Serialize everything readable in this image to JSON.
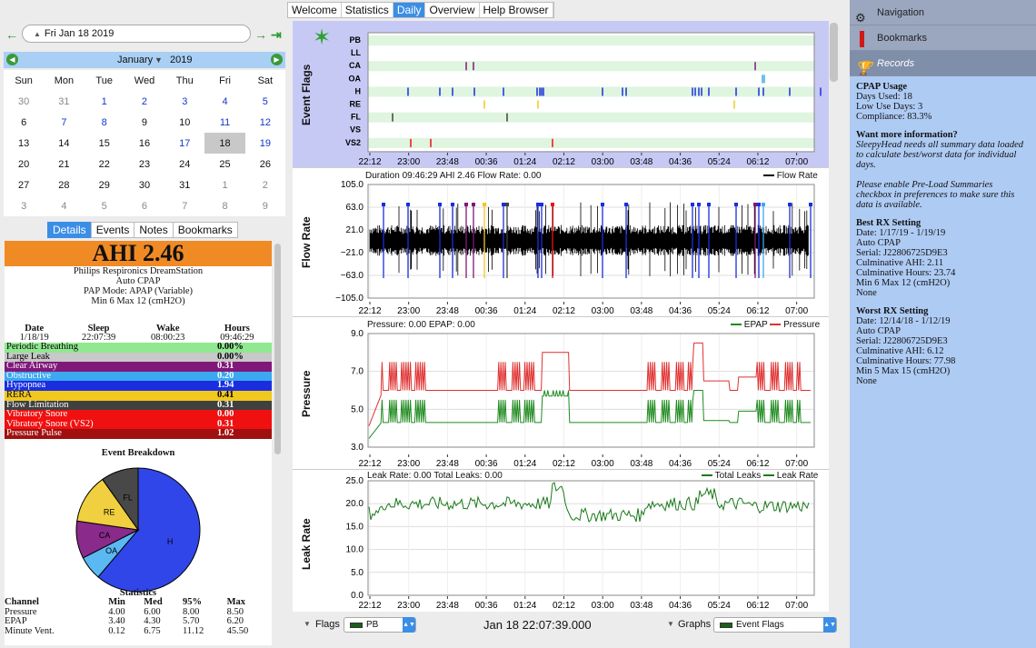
{
  "app_tabs": [
    "Welcome",
    "Statistics",
    "Daily",
    "Overview",
    "Help Browser"
  ],
  "active_tab": "Daily",
  "date_selector": {
    "value": "Fri Jan 18 2019"
  },
  "calendar": {
    "month": "January",
    "year": "2019",
    "weekdays": [
      "Sun",
      "Mon",
      "Tue",
      "Wed",
      "Thu",
      "Fri",
      "Sat"
    ],
    "weeks": [
      [
        "30",
        "31",
        "1",
        "2",
        "3",
        "4",
        "5"
      ],
      [
        "6",
        "7",
        "8",
        "9",
        "10",
        "11",
        "12"
      ],
      [
        "13",
        "14",
        "15",
        "16",
        "17",
        "18",
        "19"
      ],
      [
        "20",
        "21",
        "22",
        "23",
        "24",
        "25",
        "26"
      ],
      [
        "27",
        "28",
        "29",
        "30",
        "31",
        "1",
        "2"
      ],
      [
        "3",
        "4",
        "5",
        "6",
        "7",
        "8",
        "9"
      ]
    ],
    "selected": "18"
  },
  "detail_tabs": [
    "Details",
    "Events",
    "Notes",
    "Bookmarks"
  ],
  "details": {
    "ahi": "AHI 2.46",
    "machine": "Philips Respironics DreamStation",
    "mode": "Auto CPAP",
    "pap_mode": "PAP Mode: APAP (Variable)",
    "pressure_range": "Min 6 Max 12 (cmH2O)",
    "summary_headers": [
      "Date",
      "Sleep",
      "Wake",
      "Hours"
    ],
    "summary_values": [
      "1/18/19",
      "22:07:39",
      "08:00:23",
      "09:46:29"
    ],
    "events": [
      {
        "name": "Periodic Breathing",
        "value": "0.00%",
        "color": "#90e890",
        "text": "#000"
      },
      {
        "name": "Large Leak",
        "value": "0.00%",
        "color": "#c8c8c8",
        "text": "#000"
      },
      {
        "name": "Clear Airway",
        "value": "0.31",
        "color": "#80187a",
        "text": "#fff"
      },
      {
        "name": "Obstructive",
        "value": "0.20",
        "color": "#3ba8f0",
        "text": "#fff"
      },
      {
        "name": "Hypopnea",
        "value": "1.94",
        "color": "#1a2ee0",
        "text": "#fff"
      },
      {
        "name": "RERA",
        "value": "0.41",
        "color": "#f0c81e",
        "text": "#000"
      },
      {
        "name": "Flow Limitation",
        "value": "0.31",
        "color": "#404040",
        "text": "#fff"
      },
      {
        "name": "Vibratory Snore",
        "value": "0.00",
        "color": "#f01010",
        "text": "#fff"
      },
      {
        "name": "Vibratory Snore (VS2)",
        "value": "0.31",
        "color": "#f01010",
        "text": "#fff"
      },
      {
        "name": "Pressure Pulse",
        "value": "1.02",
        "color": "#a01010",
        "text": "#fff"
      }
    ],
    "event_breakdown_title": "Event Breakdown",
    "pie": [
      {
        "label": "H",
        "value": 1.94,
        "color": "#3046e8"
      },
      {
        "label": "OA",
        "value": 0.2,
        "color": "#5ab8f2"
      },
      {
        "label": "CA",
        "value": 0.31,
        "color": "#8a2a8a"
      },
      {
        "label": "RE",
        "value": 0.41,
        "color": "#f0d040"
      },
      {
        "label": "FL",
        "value": 0.31,
        "color": "#484848"
      }
    ],
    "statistics_title": "Statistics",
    "stats_headers": [
      "Channel",
      "Min",
      "Med",
      "95%",
      "Max"
    ],
    "stats_rows": [
      [
        "Pressure",
        "4.00",
        "6.00",
        "8.00",
        "8.50"
      ],
      [
        "EPAP",
        "3.40",
        "4.30",
        "5.70",
        "6.20"
      ],
      [
        "Minute Vent.",
        "0.12",
        "6.75",
        "11.12",
        "45.50"
      ]
    ]
  },
  "graphs": {
    "time_ticks": [
      "22:12",
      "23:00",
      "23:48",
      "00:36",
      "01:24",
      "02:12",
      "03:00",
      "03:48",
      "04:36",
      "05:24",
      "06:12",
      "07:00"
    ],
    "event_flags": {
      "label": "Event Flags",
      "rows": [
        "PB",
        "LL",
        "CA",
        "OA",
        "H",
        "RE",
        "FL",
        "VS",
        "VS2"
      ]
    },
    "flow_rate": {
      "label": "Flow Rate",
      "header": "Duration 09:46:29 AHI 2.46 Flow Rate: 0.00",
      "legend": "Flow Rate",
      "yticks": [
        "105.0",
        "63.0",
        "21.0",
        "−21.0",
        "−63.0",
        "−105.0"
      ]
    },
    "pressure": {
      "label": "Pressure",
      "header": "Pressure: 0.00 EPAP: 0.00",
      "legend": [
        "EPAP",
        "Pressure"
      ],
      "yticks": [
        "9.0",
        "7.0",
        "5.0",
        "3.0"
      ]
    },
    "leak": {
      "label": "Leak Rate",
      "header": "Leak Rate: 0.00 Total Leaks: 0.00",
      "legend": [
        "Total Leaks",
        "Leak Rate"
      ],
      "yticks": [
        "25.0",
        "20.0",
        "15.0",
        "10.0",
        "5.0",
        "0.0"
      ]
    }
  },
  "bottom_bar": {
    "flags_label": "Flags",
    "flags_value": "PB",
    "timestamp": "Jan 18 22:07:39.000",
    "graphs_label": "Graphs",
    "graphs_value": "Event Flags"
  },
  "sidebar": {
    "items": [
      "Navigation",
      "Bookmarks",
      "Records"
    ],
    "selected": "Records"
  },
  "records": {
    "cpap_usage_title": "CPAP Usage",
    "cpap_usage": [
      "Days Used: 18",
      "Low Use Days: 3",
      "Compliance: 83.3%"
    ],
    "more_info_title": "Want more information?",
    "more_info_1": "SleepyHead needs all summary data loaded to calculate best/worst data for individual days.",
    "more_info_2": "Please enable Pre-Load Summaries checkbox in preferences to make sure this data is available.",
    "best_title": "Best RX Setting",
    "best": [
      "Date: 1/17/19 - 1/19/19",
      "Auto CPAP",
      "Serial: J22806725D9E3",
      "Culminative AHI: 2.11",
      "Culminative Hours: 23.74",
      "Min 6 Max 12 (cmH2O)",
      "None"
    ],
    "worst_title": "Worst RX Setting",
    "worst": [
      "Date: 12/14/18 - 1/12/19",
      "Auto CPAP",
      "Serial: J22806725D9E3",
      "Culminative AHI: 6.12",
      "Culminative Hours: 77.98",
      "Min 5 Max 15 (cmH2O)",
      "None"
    ]
  },
  "colors": {
    "accent": "#3b8ee6",
    "pressure": "#e03030",
    "epap": "#1f8a1f",
    "leak": "#1a7a1a"
  }
}
